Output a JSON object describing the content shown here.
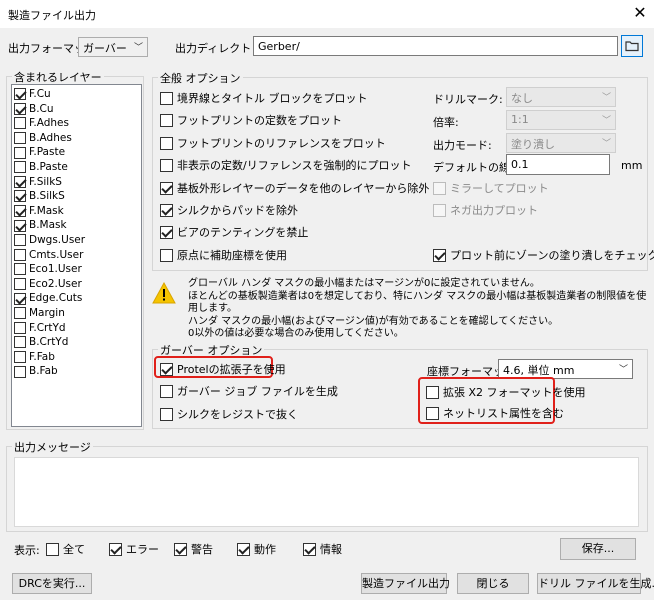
{
  "window": {
    "title": "製造ファイル出力",
    "close_glyph": "✕"
  },
  "top": {
    "format_label": "出力フォーマット:",
    "format_value": "ガーバー",
    "dir_label": "出力ディレクトリー:",
    "dir_value": "Gerber/"
  },
  "layers": {
    "title": "含まれるレイヤー",
    "items": [
      {
        "name": "F.Cu",
        "checked": true
      },
      {
        "name": "B.Cu",
        "checked": true
      },
      {
        "name": "F.Adhes",
        "checked": false
      },
      {
        "name": "B.Adhes",
        "checked": false
      },
      {
        "name": "F.Paste",
        "checked": false
      },
      {
        "name": "B.Paste",
        "checked": false
      },
      {
        "name": "F.SilkS",
        "checked": true
      },
      {
        "name": "B.SilkS",
        "checked": true
      },
      {
        "name": "F.Mask",
        "checked": true
      },
      {
        "name": "B.Mask",
        "checked": true
      },
      {
        "name": "Dwgs.User",
        "checked": false
      },
      {
        "name": "Cmts.User",
        "checked": false
      },
      {
        "name": "Eco1.User",
        "checked": false
      },
      {
        "name": "Eco2.User",
        "checked": false
      },
      {
        "name": "Edge.Cuts",
        "checked": true
      },
      {
        "name": "Margin",
        "checked": false
      },
      {
        "name": "F.CrtYd",
        "checked": false
      },
      {
        "name": "B.CrtYd",
        "checked": false
      },
      {
        "name": "F.Fab",
        "checked": false
      },
      {
        "name": "B.Fab",
        "checked": false
      }
    ]
  },
  "general": {
    "title": "全般 オプション",
    "left_checks": [
      {
        "label": "境界線とタイトル ブロックをプロット",
        "checked": false
      },
      {
        "label": "フットプリントの定数をプロット",
        "checked": false
      },
      {
        "label": "フットプリントのリファレンスをプロット",
        "checked": false
      },
      {
        "label": "非表示の定数/リファレンスを強制的にプロット",
        "checked": false
      },
      {
        "label": "基板外形レイヤーのデータを他のレイヤーから除外",
        "checked": true
      },
      {
        "label": "シルクからパッドを除外",
        "checked": true
      },
      {
        "label": "ビアのテンティングを禁止",
        "checked": true
      },
      {
        "label": "原点に補助座標を使用",
        "checked": false
      }
    ],
    "drill_mark_label": "ドリルマーク:",
    "drill_mark_value": "なし",
    "scale_label": "倍率:",
    "scale_value": "1:1",
    "output_mode_label": "出力モード:",
    "output_mode_value": "塗り潰し",
    "line_width_label": "デフォルトの線幅:",
    "line_width_value": "0.1",
    "line_width_unit": "mm",
    "mirror_label": "ミラーしてプロット",
    "negative_label": "ネガ出力プロット",
    "refill_label": "プロット前にゾーンの塗り潰しをチェック"
  },
  "warning": {
    "lines": [
      "グローバル ハンダ マスクの最小幅またはマージンが0に設定されていません。",
      "ほとんどの基板製造業者は0を想定しており、特にハンダ マスクの最小幅は基板製造業者の制限値を使用します。",
      "ハンダ マスクの最小幅(およびマージン値)が有効であることを確認してください。",
      "0以外の値は必要な場合のみ使用してください。"
    ]
  },
  "gerber": {
    "title": "ガーバー オプション",
    "protel_label": "Protelの拡張子を使用",
    "job_label": "ガーバー ジョブ ファイルを生成",
    "subtract_label": "シルクをレジストで抜く",
    "coord_label": "座標フォーマット:",
    "coord_value": "4.6, 単位 mm",
    "x2_label": "拡張 X2 フォーマットを使用",
    "netlist_label": "ネットリスト属性を含む"
  },
  "messages": {
    "title": "出力メッセージ",
    "show_label": "表示:",
    "filters": [
      "全て",
      "エラー",
      "警告",
      "動作",
      "情報"
    ],
    "save_label": "保存..."
  },
  "bottom": {
    "drc": "DRCを実行...",
    "plot": "製造ファイル出力",
    "close": "閉じる",
    "drill": "ドリル ファイルを生成..."
  }
}
